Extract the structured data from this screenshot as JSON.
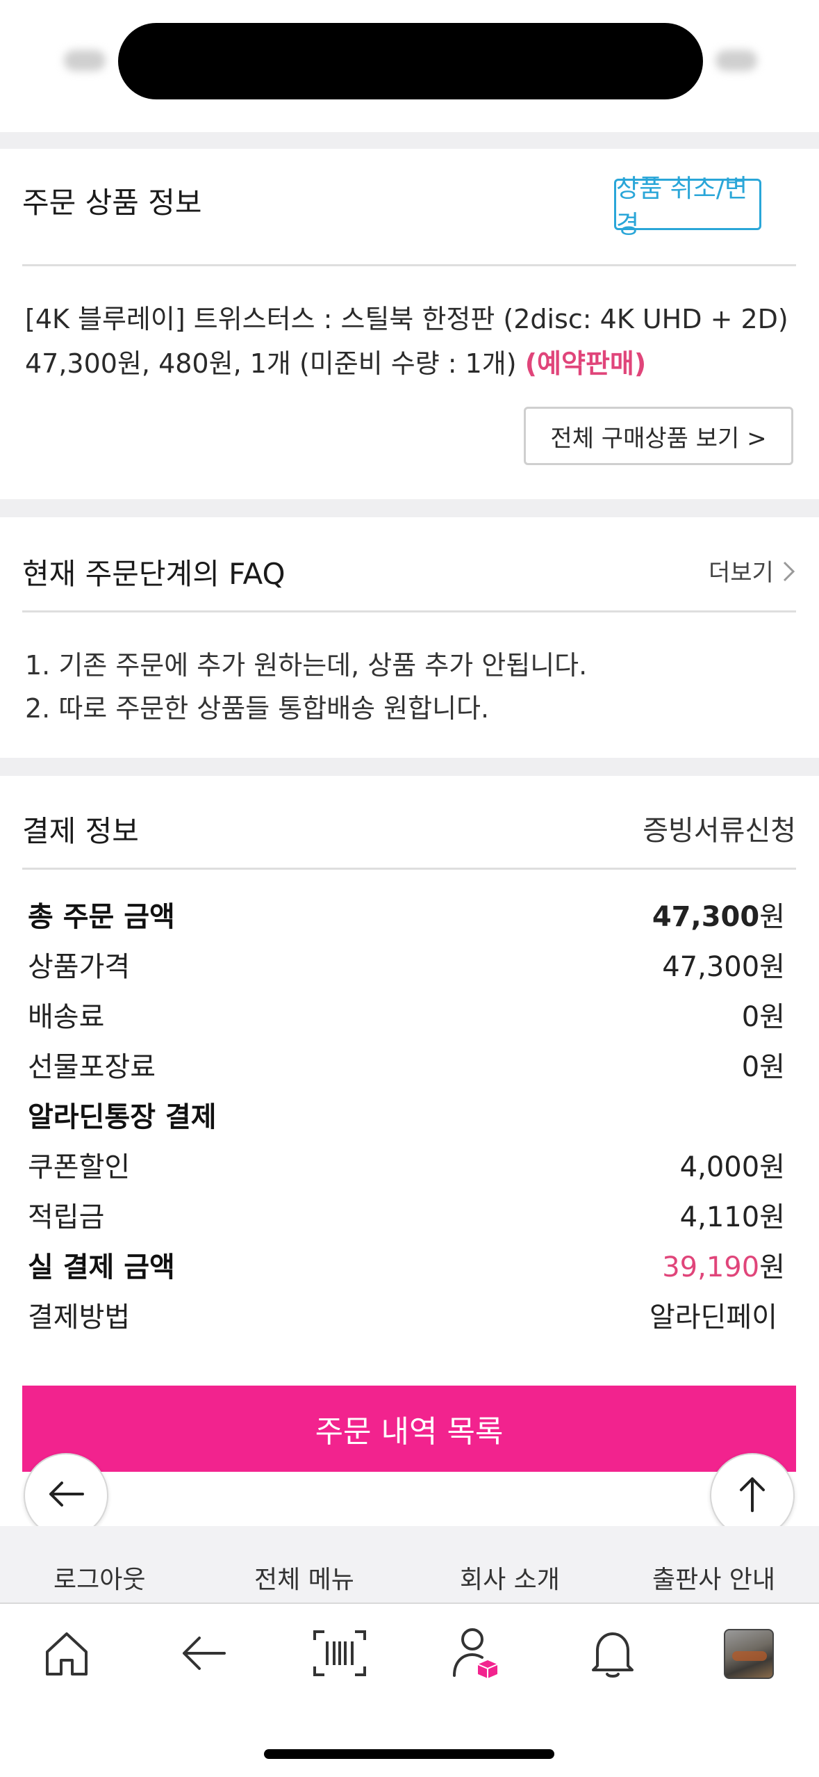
{
  "order_product": {
    "title": "주문 상품 정보",
    "cancel_button": "상품 취소/변경",
    "product_line1": "[4K 블루레이] 트위스터스 : 스틸북 한정판 (2disc: 4K UHD + 2D)",
    "product_line2": "47,300원, 480원, 1개 (미준비 수량 : 1개)",
    "status_badge": "(예약판매)",
    "view_all_button": "전체 구매상품 보기 >"
  },
  "faq": {
    "title": "현재 주문단계의 FAQ",
    "more_label": "더보기",
    "items": [
      "1. 기존 주문에 추가 원하는데, 상품 추가 안됩니다.",
      "2. 따로 주문한 상품들 통합배송 원합니다."
    ]
  },
  "payment": {
    "title": "결제 정보",
    "receipt_link": "증빙서류신청",
    "rows": [
      {
        "label": "총 주문 금액",
        "amount": "47,300",
        "unit": "원"
      },
      {
        "label": "상품가격",
        "amount": "47,300",
        "unit": "원"
      },
      {
        "label": "배송료",
        "amount": "0",
        "unit": "원"
      },
      {
        "label": "선물포장료",
        "amount": "0",
        "unit": "원"
      },
      {
        "label": "알라딘통장 결제",
        "amount": "",
        "unit": ""
      },
      {
        "label": "쿠폰할인",
        "amount": "4,000",
        "unit": "원"
      },
      {
        "label": "적립금",
        "amount": "4,110",
        "unit": "원"
      },
      {
        "label": "실 결제 금액",
        "amount": "39,190",
        "unit": "원"
      },
      {
        "label": "결제방법",
        "amount": "알라딘페이",
        "unit": ""
      }
    ]
  },
  "cta": {
    "label": "주문 내역 목록"
  },
  "footer_links": [
    "로그아웃",
    "전체 메뉴",
    "회사 소개",
    "출판사 안내"
  ],
  "tab_bar": {
    "icons": [
      "home-icon",
      "back-icon",
      "barcode-icon",
      "my-account-icon",
      "notification-bell-icon",
      "profile-thumbnail"
    ]
  },
  "colors": {
    "accent_pink": "#f2238e",
    "price_pink": "#e0457a",
    "link_blue": "#2aa6d8"
  }
}
